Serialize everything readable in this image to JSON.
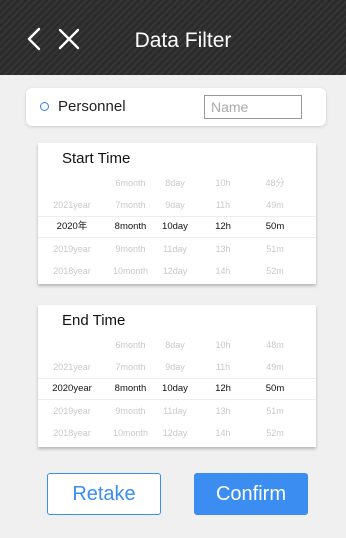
{
  "header": {
    "title": "Data Filter",
    "back_icon": "chevron-left-icon",
    "close_icon": "close-icon"
  },
  "personnel": {
    "label": "Personnel",
    "input_placeholder": "Name",
    "input_value": ""
  },
  "start_time": {
    "title": "Start Time",
    "rows": [
      [
        "",
        "6month",
        "8day",
        "10h",
        "48分"
      ],
      [
        "2021year",
        "7month",
        "9day",
        "11h",
        "49m"
      ],
      [
        "2020年",
        "8month",
        "10day",
        "12h",
        "50m"
      ],
      [
        "2019year",
        "9month",
        "11day",
        "13h",
        "51m"
      ],
      [
        "2018year",
        "10month",
        "12day",
        "14h",
        "52m"
      ]
    ],
    "selected_row": 2
  },
  "end_time": {
    "title": "End Time",
    "rows": [
      [
        "",
        "6month",
        "8day",
        "10h",
        "48m"
      ],
      [
        "2021year",
        "7month",
        "9day",
        "11h",
        "49m"
      ],
      [
        "2020year",
        "8month",
        "10day",
        "12h",
        "50m"
      ],
      [
        "2019year",
        "9month",
        "11day",
        "13h",
        "51m"
      ],
      [
        "2018year",
        "10month",
        "12day",
        "14h",
        "52m"
      ]
    ],
    "selected_row": 2
  },
  "buttons": {
    "retake": "Retake",
    "confirm": "Confirm"
  },
  "colors": {
    "accent": "#3b8df1",
    "header_bg": "#2b2b2b",
    "page_bg": "#f0f0f0"
  }
}
